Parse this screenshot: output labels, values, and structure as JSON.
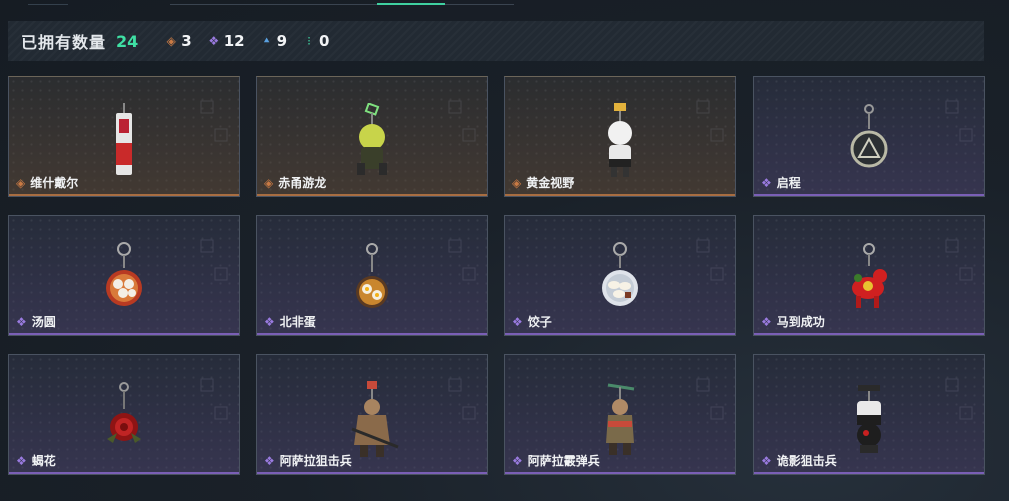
{
  "summary": {
    "label": "已拥有数量",
    "total": "24",
    "counts": [
      {
        "icon": "gold-rarity-icon",
        "glyph": "◈",
        "color": "#c97a44",
        "value": "3"
      },
      {
        "icon": "purple-rarity-icon",
        "glyph": "❖",
        "color": "#9a7be0",
        "value": "12"
      },
      {
        "icon": "blue-rarity-icon",
        "glyph": "⯅",
        "color": "#5aa0e0",
        "value": "9"
      },
      {
        "icon": "green-rarity-icon",
        "glyph": "⁝",
        "color": "#3fd1a0",
        "value": "0"
      }
    ]
  },
  "items": [
    {
      "name": "维什戴尔",
      "rarity": "gold",
      "glyph": "◈",
      "glyph_color": "#c97a44",
      "icon": "red-white-phone-charm-icon"
    },
    {
      "name": "赤甬游龙",
      "rarity": "gold",
      "glyph": "◈",
      "glyph_color": "#c97a44",
      "icon": "dragon-figure-charm-icon"
    },
    {
      "name": "黄金视野",
      "rarity": "gold",
      "glyph": "◈",
      "glyph_color": "#c97a44",
      "icon": "white-figure-charm-icon"
    },
    {
      "name": "启程",
      "rarity": "purple",
      "glyph": "❖",
      "glyph_color": "#9a7be0",
      "icon": "round-medallion-charm-icon"
    },
    {
      "name": "汤圆",
      "rarity": "purple",
      "glyph": "❖",
      "glyph_color": "#9a7be0",
      "icon": "tangyuan-bowl-charm-icon"
    },
    {
      "name": "北非蛋",
      "rarity": "purple",
      "glyph": "❖",
      "glyph_color": "#9a7be0",
      "icon": "shakshuka-pan-charm-icon"
    },
    {
      "name": "饺子",
      "rarity": "purple",
      "glyph": "❖",
      "glyph_color": "#9a7be0",
      "icon": "dumpling-plate-charm-icon"
    },
    {
      "name": "马到成功",
      "rarity": "purple",
      "glyph": "❖",
      "glyph_color": "#9a7be0",
      "icon": "red-horse-charm-icon"
    },
    {
      "name": "蝎花",
      "rarity": "purple",
      "glyph": "❖",
      "glyph_color": "#9a7be0",
      "icon": "red-rose-charm-icon"
    },
    {
      "name": "阿萨拉狙击兵",
      "rarity": "purple",
      "glyph": "❖",
      "glyph_color": "#9a7be0",
      "icon": "sniper-soldier-charm-icon"
    },
    {
      "name": "阿萨拉霰弹兵",
      "rarity": "purple",
      "glyph": "❖",
      "glyph_color": "#9a7be0",
      "icon": "shotgun-soldier-charm-icon"
    },
    {
      "name": "诡影狙击兵",
      "rarity": "purple",
      "glyph": "❖",
      "glyph_color": "#9a7be0",
      "icon": "shadow-sniper-charm-icon"
    }
  ]
}
